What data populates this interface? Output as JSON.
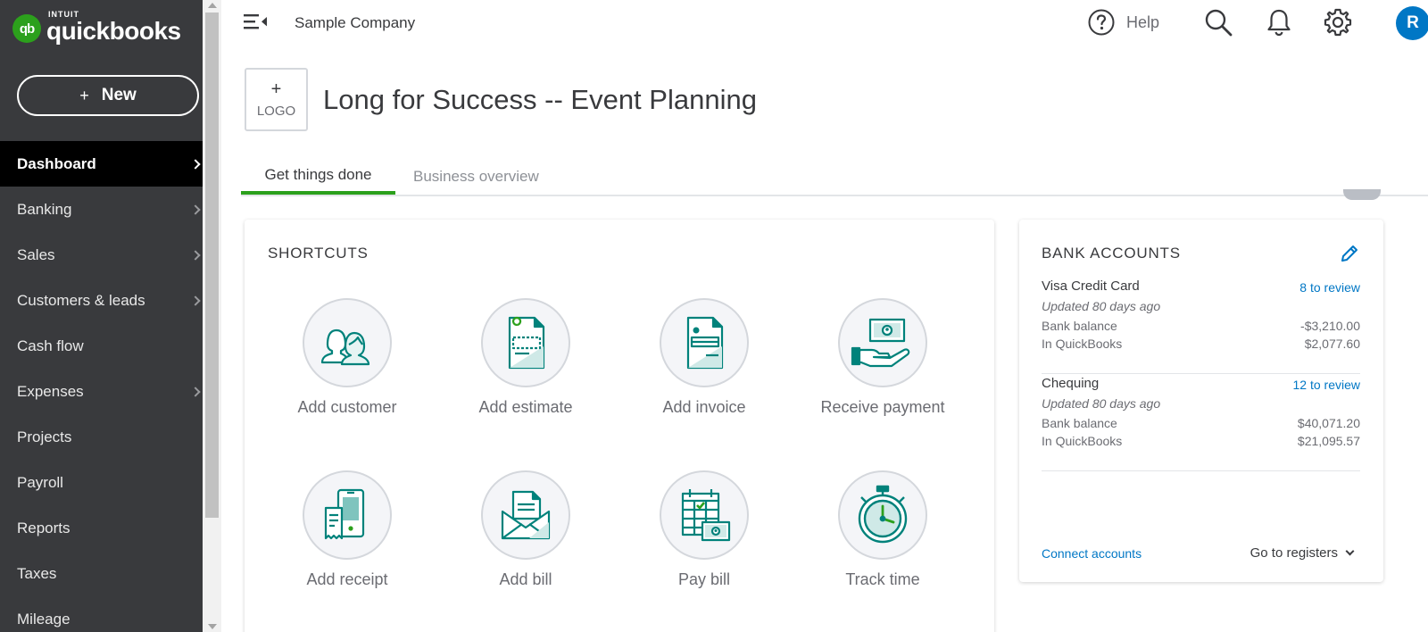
{
  "brand": {
    "intuit": "INTUIT",
    "name": "quickbooks",
    "mark": "qb"
  },
  "sidebar": {
    "new_label": "New",
    "new_plus": "+",
    "items": [
      {
        "label": "Dashboard",
        "active": true,
        "chevron": true
      },
      {
        "label": "Banking",
        "chevron": true
      },
      {
        "label": "Sales",
        "chevron": true
      },
      {
        "label": "Customers & leads",
        "chevron": true
      },
      {
        "label": "Cash flow",
        "chevron": false
      },
      {
        "label": "Expenses",
        "chevron": true
      },
      {
        "label": "Projects",
        "chevron": false
      },
      {
        "label": "Payroll",
        "chevron": false
      },
      {
        "label": "Reports",
        "chevron": false
      },
      {
        "label": "Taxes",
        "chevron": false
      },
      {
        "label": "Mileage",
        "chevron": false
      }
    ]
  },
  "topbar": {
    "company": "Sample Company",
    "help_label": "Help",
    "avatar_initial": "R"
  },
  "header": {
    "logo_plus": "+",
    "logo_label": "LOGO",
    "title": "Long for Success -- Event Planning"
  },
  "tabs": [
    {
      "label": "Get things done",
      "active": true
    },
    {
      "label": "Business overview",
      "active": false
    }
  ],
  "shortcuts": {
    "title": "SHORTCUTS",
    "items": [
      {
        "label": "Add customer",
        "icon": "customer-icon"
      },
      {
        "label": "Add estimate",
        "icon": "estimate-icon"
      },
      {
        "label": "Add invoice",
        "icon": "invoice-icon"
      },
      {
        "label": "Receive payment",
        "icon": "payment-icon"
      },
      {
        "label": "Add receipt",
        "icon": "receipt-icon"
      },
      {
        "label": "Add bill",
        "icon": "bill-icon"
      },
      {
        "label": "Pay bill",
        "icon": "pay-bill-icon"
      },
      {
        "label": "Track time",
        "icon": "stopwatch-icon"
      }
    ]
  },
  "bank_accounts": {
    "title": "BANK ACCOUNTS",
    "accounts": [
      {
        "name": "Visa Credit Card",
        "review": "8 to review",
        "updated": "Updated 80 days ago",
        "bank_balance_label": "Bank balance",
        "bank_balance": "-$3,210.00",
        "qb_label": "In QuickBooks",
        "qb_balance": "$2,077.60"
      },
      {
        "name": "Chequing",
        "review": "12 to review",
        "updated": "Updated 80 days ago",
        "bank_balance_label": "Bank balance",
        "bank_balance": "$40,071.20",
        "qb_label": "In QuickBooks",
        "qb_balance": "$21,095.57"
      }
    ],
    "connect_label": "Connect accounts",
    "registers_label": "Go to registers"
  },
  "colors": {
    "sidebar_bg": "#393a3d",
    "brand_green": "#2ca01c",
    "link_blue": "#0077c5",
    "icon_teal": "#00827b"
  }
}
